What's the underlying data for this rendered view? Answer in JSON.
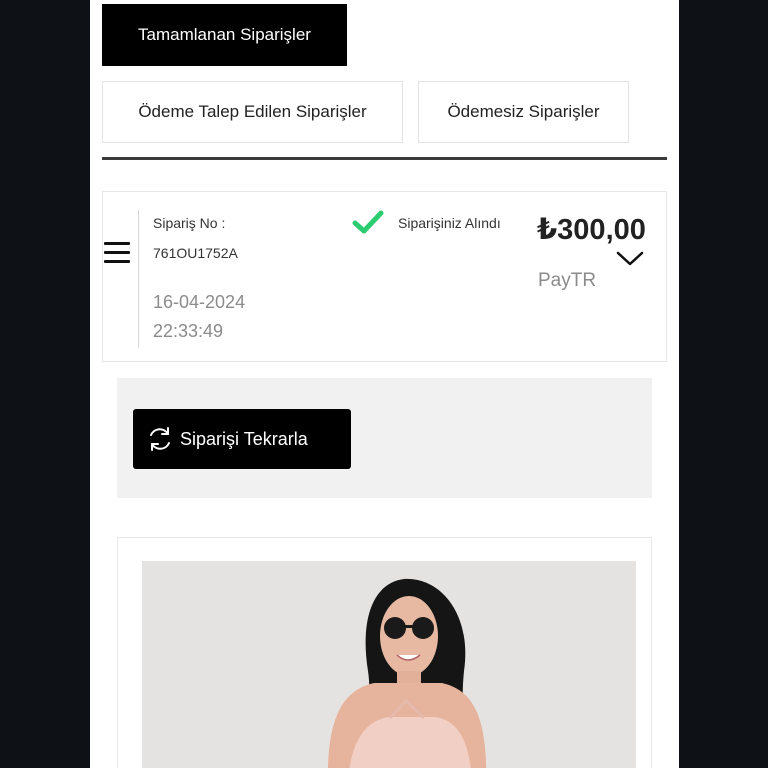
{
  "tabs": {
    "completed": "Tamamlanan Siparişler",
    "payment_requested": "Ödeme Talep Edilen Siparişler",
    "unpaid": "Ödemesiz Siparişler"
  },
  "order": {
    "no_label": "Sipariş No :",
    "number": "761OU1752A",
    "date": "16-04-2024",
    "time": "22:33:49",
    "status": "Siparişiniz Alındı",
    "total": "₺300,00",
    "payment_method": "PayTR"
  },
  "actions": {
    "repeat_label": "Siparişi Tekrarla"
  },
  "colors": {
    "accent": "#000000",
    "success": "#2ecc71",
    "muted": "#8b8b8b",
    "panel": "#f1f1f1",
    "frame": "#0e1217"
  },
  "icons": {
    "menu": "menu-icon",
    "status": "check-icon",
    "expand": "chevron-down-icon",
    "repeat": "refresh-icon"
  }
}
